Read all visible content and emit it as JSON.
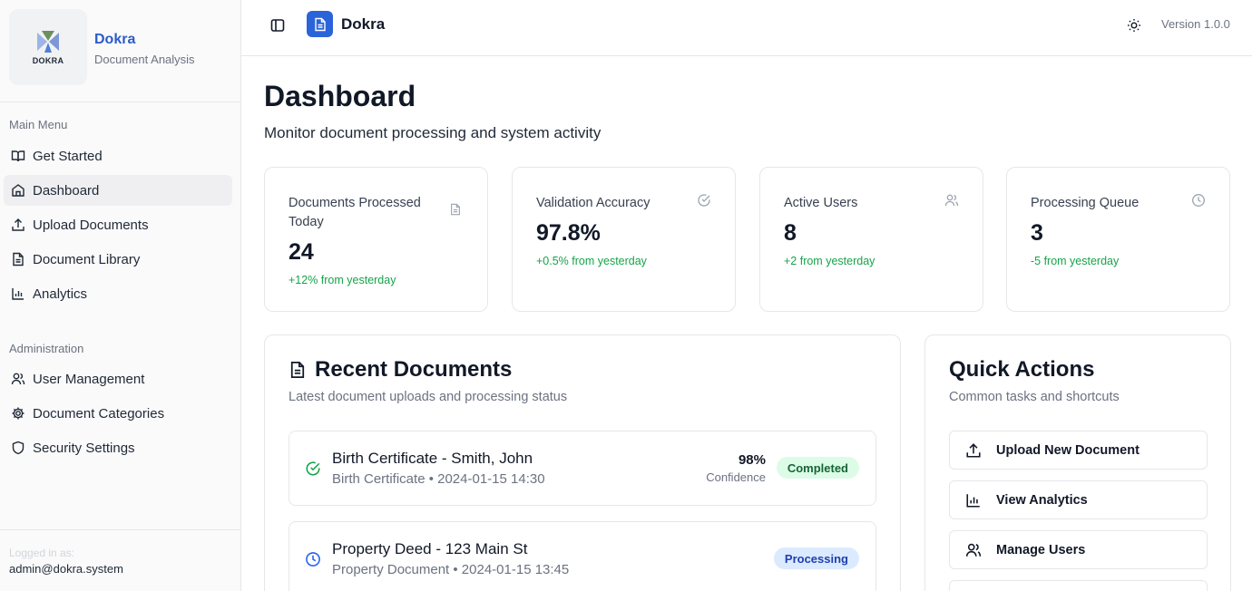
{
  "sidebar": {
    "brand": {
      "name": "Dokra",
      "subtitle": "Document Analysis",
      "logo_text": "DOKRA"
    },
    "main_menu_label": "Main Menu",
    "main_items": [
      {
        "label": "Get Started",
        "icon": "book-open-icon"
      },
      {
        "label": "Dashboard",
        "icon": "home-icon",
        "active": true
      },
      {
        "label": "Upload Documents",
        "icon": "upload-icon"
      },
      {
        "label": "Document Library",
        "icon": "file-text-icon"
      },
      {
        "label": "Analytics",
        "icon": "bar-chart-icon"
      }
    ],
    "admin_label": "Administration",
    "admin_items": [
      {
        "label": "User Management",
        "icon": "users-icon"
      },
      {
        "label": "Document Categories",
        "icon": "gear-icon"
      },
      {
        "label": "Security Settings",
        "icon": "shield-icon"
      }
    ],
    "footer": {
      "logged_in_label": "Logged in as:",
      "user": "admin@dokra.system"
    }
  },
  "header": {
    "title": "Dokra",
    "version": "Version 1.0.0"
  },
  "page": {
    "title": "Dashboard",
    "subtitle": "Monitor document processing and system activity"
  },
  "stats": [
    {
      "label": "Documents Processed Today",
      "value": "24",
      "delta": "+12% from yesterday",
      "icon": "file-icon"
    },
    {
      "label": "Validation Accuracy",
      "value": "97.8%",
      "delta": "+0.5% from yesterday",
      "icon": "check-circle-icon"
    },
    {
      "label": "Active Users",
      "value": "8",
      "delta": "+2 from yesterday",
      "icon": "users-icon"
    },
    {
      "label": "Processing Queue",
      "value": "3",
      "delta": "-5 from yesterday",
      "icon": "clock-icon"
    }
  ],
  "recent": {
    "title": "Recent Documents",
    "subtitle": "Latest document uploads and processing status",
    "items": [
      {
        "title": "Birth Certificate - Smith, John",
        "meta": "Birth Certificate • 2024-01-15 14:30",
        "confidence": "98%",
        "confidence_label": "Confidence",
        "status": "Completed"
      },
      {
        "title": "Property Deed - 123 Main St",
        "meta": "Property Document • 2024-01-15 13:45",
        "status": "Processing"
      }
    ]
  },
  "quick_actions": {
    "title": "Quick Actions",
    "subtitle": "Common tasks and shortcuts",
    "items": [
      {
        "label": "Upload New Document",
        "icon": "upload-icon"
      },
      {
        "label": "View Analytics",
        "icon": "bar-chart-icon"
      },
      {
        "label": "Manage Users",
        "icon": "users-icon"
      }
    ]
  },
  "colors": {
    "brand": "#2b5cc8",
    "accent": "#2b63d9",
    "positive": "#16a34a"
  }
}
